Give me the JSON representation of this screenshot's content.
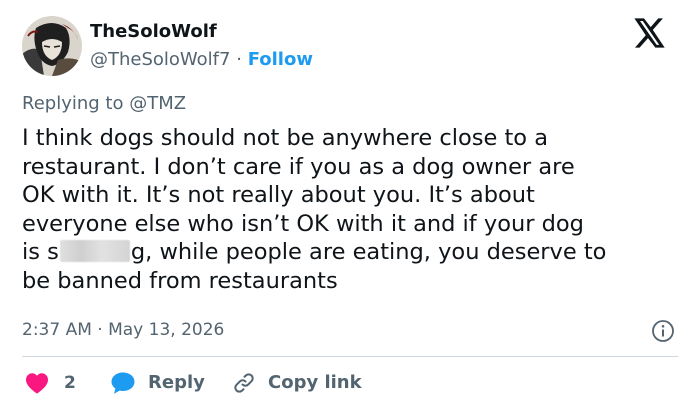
{
  "author": {
    "display_name": "TheSoloWolf",
    "handle": "@TheSoloWolf7",
    "separator": "·",
    "follow_label": "Follow"
  },
  "reply_context": {
    "prefix": "Replying to",
    "mention": "@TMZ"
  },
  "tweet": {
    "lines": [
      "I think dogs should not be anywhere close to a",
      "restaurant. I don’t care if you as a dog owner are",
      "OK with it. It’s not really about you. It’s about",
      "everyone else who isn’t OK with it and if your dog"
    ],
    "line5_before": "is s",
    "line5_after": "g, while people are eating, you deserve to",
    "line6": "be banned from restaurants"
  },
  "timestamp": "2:37 AM · May 13, 2026",
  "actions": {
    "like_count": "2",
    "reply_label": "Reply",
    "copy_link_label": "Copy link"
  },
  "colors": {
    "accent": "#1d9bf0",
    "like": "#f91880",
    "secondary_text": "#536471",
    "primary_text": "#0f1419",
    "divider": "#cfd9de"
  },
  "icons": {
    "logo": "x-logo-icon",
    "info": "info-icon",
    "like": "heart-icon",
    "reply": "speech-bubble-icon",
    "copy_link": "link-icon"
  }
}
